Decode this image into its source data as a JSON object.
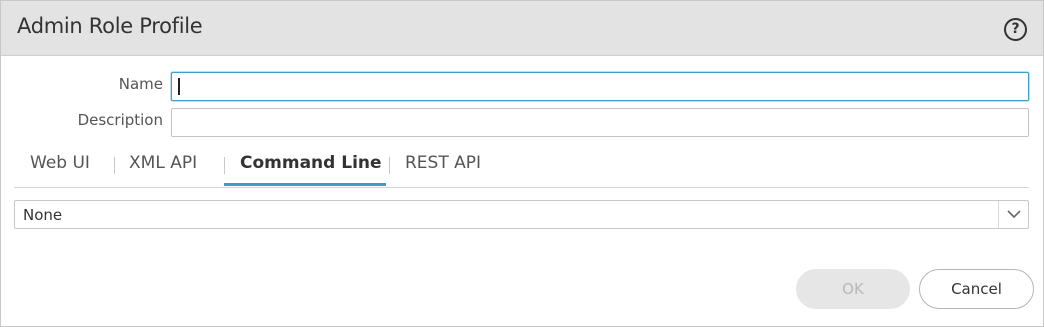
{
  "dialog": {
    "title": "Admin Role Profile",
    "help_icon": "?"
  },
  "form": {
    "name_label": "Name",
    "name_value": "",
    "description_label": "Description",
    "description_value": ""
  },
  "tabs": [
    {
      "label": "Web UI",
      "active": false
    },
    {
      "label": "XML API",
      "active": false
    },
    {
      "label": "Command Line",
      "active": true
    },
    {
      "label": "REST API",
      "active": false
    }
  ],
  "command_line": {
    "selected": "None"
  },
  "buttons": {
    "ok_label": "OK",
    "ok_enabled": false,
    "cancel_label": "Cancel"
  },
  "colors": {
    "accent": "#3a9fc8",
    "titlebar": "#e3e3e3"
  }
}
